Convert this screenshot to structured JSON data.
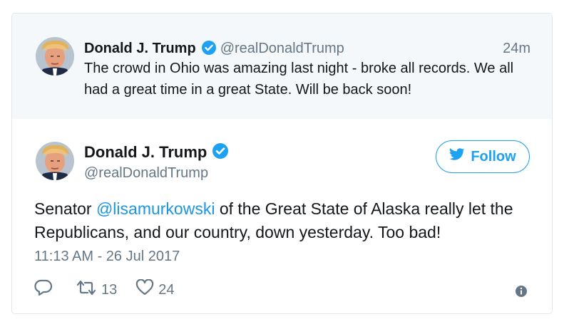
{
  "parent_tweet": {
    "name": "Donald J. Trump",
    "handle": "@realDonaldTrump",
    "time": "24m",
    "text": "The crowd in Ohio was amazing last night - broke all records. We all had a great time in a great State. Will be back soon!"
  },
  "main_tweet": {
    "name": "Donald J. Trump",
    "handle": "@realDonaldTrump",
    "follow_label": "Follow",
    "text_before": "Senator ",
    "mention": "@lisamurkowski",
    "text_after": " of the Great State of Alaska really let the Republicans, and our country, down yesterday. Too bad!",
    "timestamp": "11:13 AM - 26 Jul 2017",
    "retweets": "13",
    "likes": "24"
  },
  "icons": [
    "verified-icon",
    "twitter-bird-icon",
    "reply-icon",
    "retweet-icon",
    "like-icon",
    "info-icon"
  ],
  "colors": {
    "accent": "#1da1f2",
    "link": "#1b95e0",
    "secondary_text": "#657786",
    "parent_background": "#f5f8fa"
  }
}
